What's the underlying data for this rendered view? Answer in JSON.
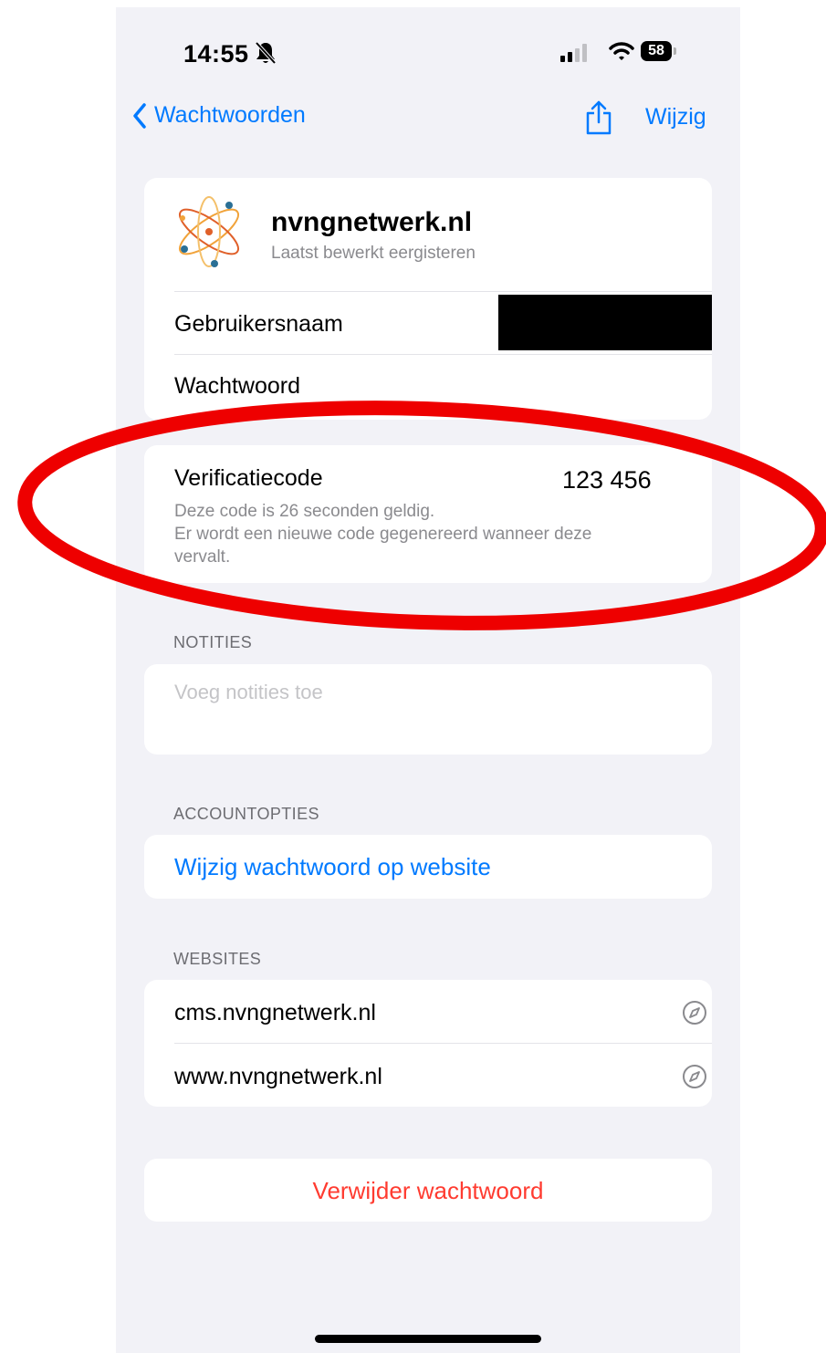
{
  "status_bar": {
    "time": "14:55",
    "battery": "58"
  },
  "nav": {
    "back_label": "Wachtwoorden",
    "edit_label": "Wijzig"
  },
  "header": {
    "site": "nvngnetwerk.nl",
    "subtitle": "Laatst bewerkt eergisteren"
  },
  "fields": {
    "username_label": "Gebruikersnaam",
    "password_label": "Wachtwoord"
  },
  "verification": {
    "label": "Verificatiecode",
    "code": "123 456",
    "note_line1": "Deze code is 26 seconden geldig.",
    "note_line2": "Er wordt een nieuwe code gegenereerd wanneer deze vervalt."
  },
  "notes": {
    "header": "NOTITIES",
    "placeholder": "Voeg notities toe"
  },
  "account": {
    "header": "ACCOUNTOPTIES",
    "change_label": "Wijzig wachtwoord op website"
  },
  "websites": {
    "header": "WEBSITES",
    "items": [
      "cms.nvngnetwerk.nl",
      "www.nvngnetwerk.nl"
    ]
  },
  "delete_label": "Verwijder wachtwoord",
  "colors": {
    "accent": "#007aff",
    "destructive": "#ff3b30",
    "annotation": "#ee0000",
    "background": "#f2f2f7"
  },
  "icons": [
    "bell-slash-icon",
    "signal-icon",
    "wifi-icon",
    "battery-icon",
    "chevron-left-icon",
    "share-icon",
    "app-logo",
    "compass-icon"
  ]
}
